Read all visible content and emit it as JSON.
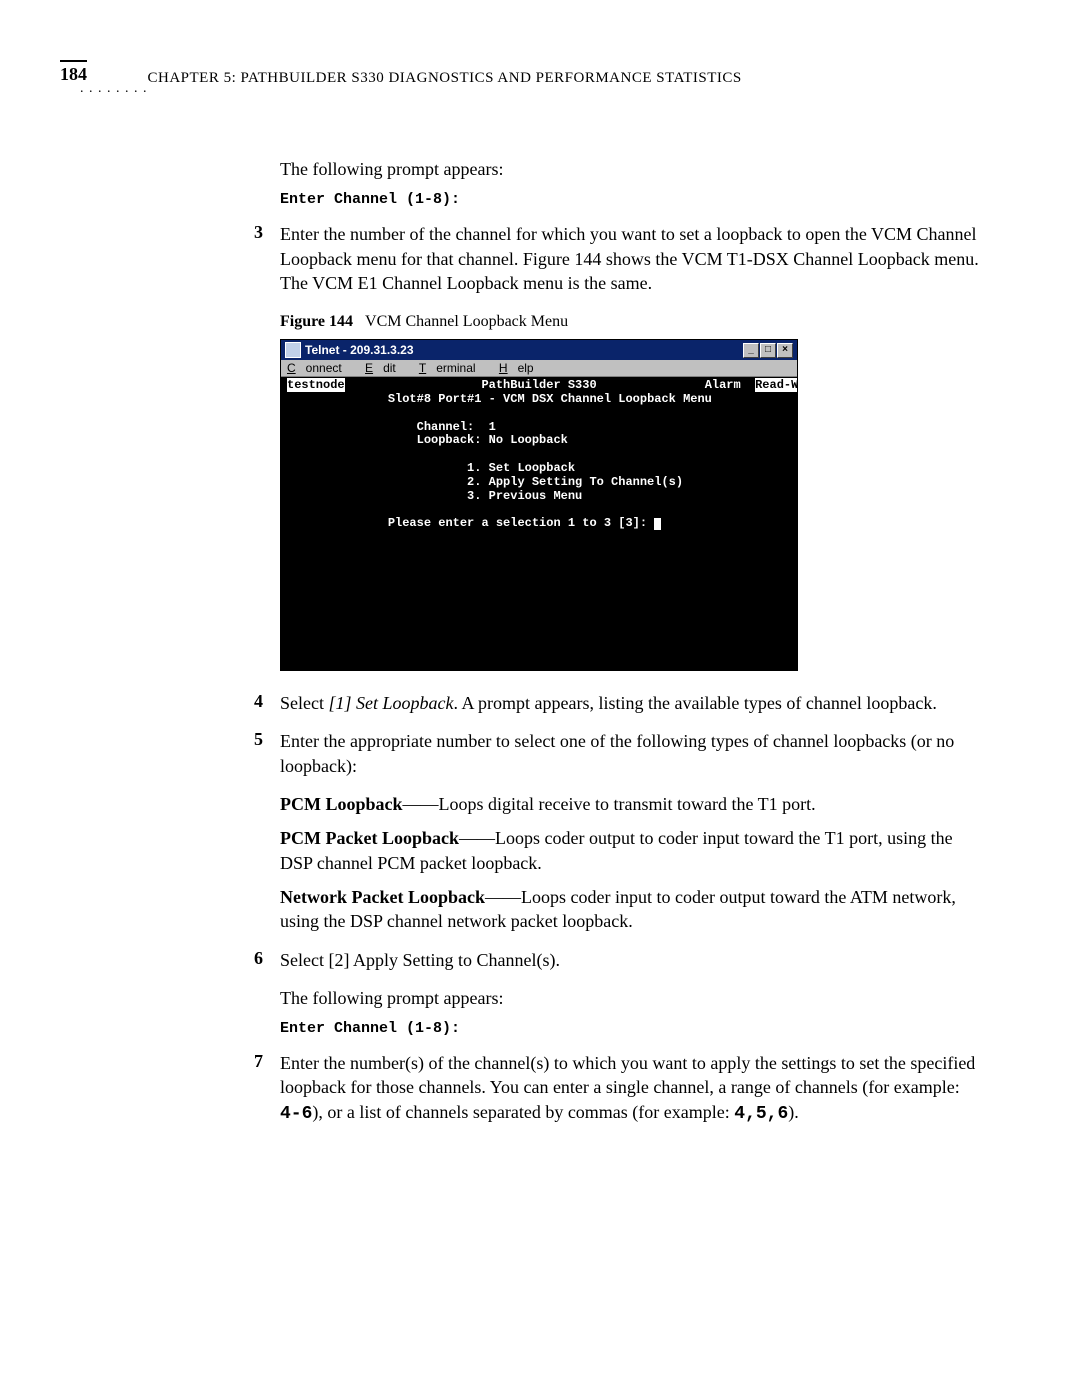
{
  "page_number": "184",
  "chapter_header": "CHAPTER 5: PATHBUILDER S330 DIAGNOSTICS AND PERFORMANCE STATISTICS",
  "intro_prompt": "The following prompt appears:",
  "code_prompt1": "Enter Channel (1-8):",
  "step3_num": "3",
  "step3_text": "Enter the number of the channel for which you want to set a loopback to open the VCM Channel Loopback menu for that channel. Figure 144 shows the VCM T1-DSX Channel Loopback menu. The VCM E1 Channel Loopback menu is the same.",
  "figure_label": "Figure 144",
  "figure_caption": "VCM Channel Loopback Menu",
  "telnet": {
    "title": "Telnet - 209.31.3.23",
    "menu": {
      "connect": "Connect",
      "edit": "Edit",
      "terminal": "Terminal",
      "help": "Help"
    },
    "line1_left": "testnode",
    "line1_center": "PathBuilder S330",
    "line1_alarm": "Alarm",
    "line1_rw": "Read-Write",
    "line2": "Slot#8 Port#1 - VCM DSX Channel Loopback Menu",
    "channel_label": "Channel:  1",
    "loopback_label": "Loopback: No Loopback",
    "opt1": "1. Set Loopback",
    "opt2": "2. Apply Setting To Channel(s)",
    "opt3": "3. Previous Menu",
    "prompt": "Please enter a selection 1 to 3 [3]: "
  },
  "step4_num": "4",
  "step4_pre": "Select ",
  "step4_italic": "[1] Set Loopback",
  "step4_post": ". A prompt appears, listing the available types of channel loopback.",
  "step5_num": "5",
  "step5_text": "Enter the appropriate number to select one of the following types of channel loopbacks (or no loopback):",
  "pcm_label": "PCM Loopback",
  "pcm_text": "——Loops digital receive to transmit toward the T1 port.",
  "pcmpkt_label": "PCM Packet Loopback",
  "pcmpkt_text": "——Loops coder output to coder input toward the T1 port, using the DSP channel PCM packet loopback.",
  "netpkt_label": "Network Packet Loopback",
  "netpkt_text": "——Loops coder input to coder output toward the ATM network, using the DSP channel network packet loopback.",
  "step6_num": "6",
  "step6_text": "Select [2] Apply Setting to Channel(s).",
  "step6_prompt_intro": "The following prompt appears:",
  "code_prompt2": "Enter Channel (1-8):",
  "step7_num": "7",
  "step7_text_a": "Enter the number(s) of the channel(s) to which you want to apply the settings to set the specified loopback for those channels. You can enter a single channel, a range of channels (for example: ",
  "step7_range": "4-6",
  "step7_text_b": "), or a list of channels separated by commas (for example: ",
  "step7_list": "4,5,6",
  "step7_text_c": ")."
}
